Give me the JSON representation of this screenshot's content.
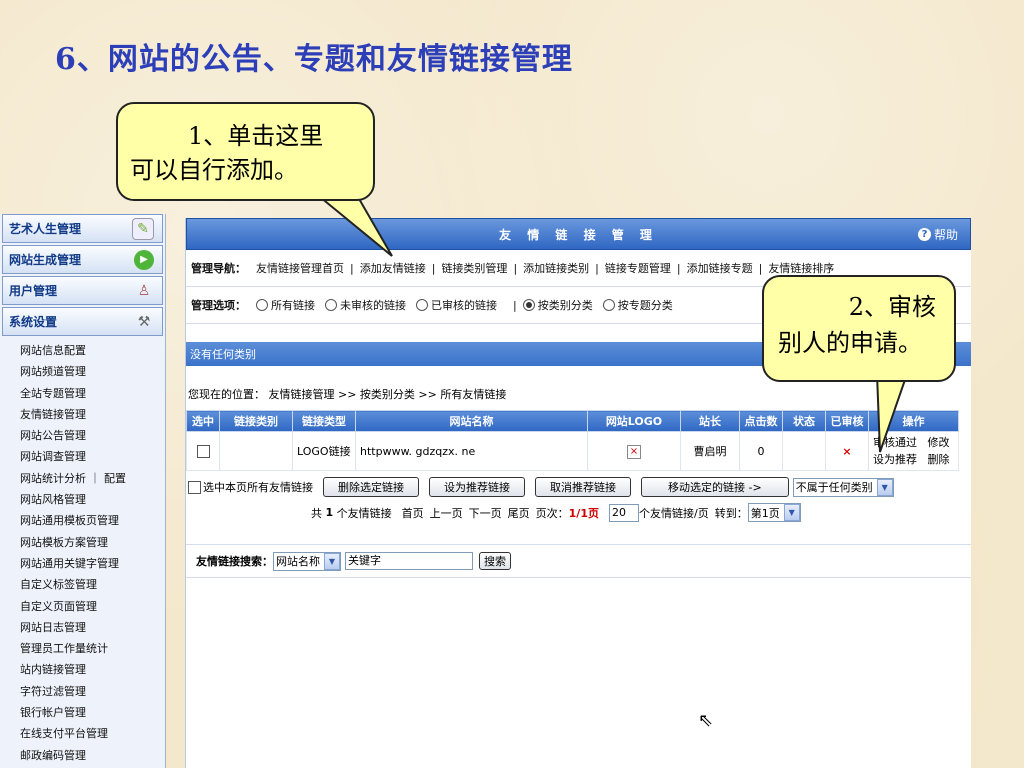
{
  "slide": {
    "title": "6、网站的公告、专题和友情链接管理",
    "callout1": {
      "line1": "1、单击这里",
      "line2": "可以自行添加。"
    },
    "callout2": {
      "line1": "2、审核",
      "line2": "别人的申请。"
    }
  },
  "sidebar": {
    "sections": [
      {
        "label": "艺术人生管理",
        "icon": "document-icon"
      },
      {
        "label": "网站生成管理",
        "icon": "play-icon"
      },
      {
        "label": "用户管理",
        "icon": "user-icon"
      },
      {
        "label": "系统设置",
        "icon": "tools-icon"
      }
    ],
    "items": [
      "网站信息配置",
      "网站频道管理",
      "全站专题管理",
      "友情链接管理",
      "网站公告管理",
      "网站调查管理",
      "网站统计分析 ｜ 配置",
      "网站风格管理",
      "网站通用模板页管理",
      "网站模板方案管理",
      "网站通用关键字管理",
      "自定义标签管理",
      "自定义页面管理",
      "网站日志管理",
      "管理员工作量统计",
      "站内链接管理",
      "字符过滤管理",
      "银行帐户管理",
      "在线支付平台管理",
      "邮政编码管理"
    ]
  },
  "main": {
    "title": "友 情 链 接 管 理",
    "help": "帮助",
    "nav": {
      "label": "管理导航：",
      "links": [
        "友情链接管理首页",
        "添加友情链接",
        "链接类别管理",
        "添加链接类别",
        "链接专题管理",
        "添加链接专题",
        "友情链接排序"
      ]
    },
    "options": {
      "label": "管理选项：",
      "radios": [
        {
          "label": "所有链接",
          "checked": false
        },
        {
          "label": "未审核的链接",
          "checked": false
        },
        {
          "label": "已审核的链接",
          "checked": false
        },
        {
          "label": "按类别分类",
          "checked": true
        },
        {
          "label": "按专题分类",
          "checked": false
        }
      ]
    },
    "category_bar": "没有任何类别",
    "breadcrumb": "您现在的位置： 友情链接管理 >> 按类别分类 >> 所有友情链接",
    "table": {
      "headers": [
        "选中",
        "链接类别",
        "链接类型",
        "网站名称",
        "网站LOGO",
        "站长",
        "点击数",
        "状态",
        "已审核",
        "操作"
      ],
      "rows": [
        {
          "category": "",
          "type": "LOGO链接",
          "name": "httpwww. gdzqzx. ne",
          "owner": "曹启明",
          "clicks": "0",
          "status": "",
          "approved": "×",
          "action1": "审核通过",
          "action2": "修改",
          "action3": "设为推荐",
          "action4": "删除"
        }
      ]
    },
    "bulk": {
      "select_all": "选中本页所有友情链接",
      "buttons": [
        "删除选定链接",
        "设为推荐链接",
        "取消推荐链接",
        "移动选定的链接 ->"
      ],
      "move_target": "不属于任何类别"
    },
    "pager": {
      "total_prefix": "共",
      "total": "1",
      "total_suffix": "个友情链接",
      "first": "首页",
      "prev": "上一页",
      "next": "下一页",
      "last": "尾页",
      "page_label": "页次：",
      "page": "1/1页",
      "per_page": "20",
      "per_page_suffix": "个友情链接/页",
      "goto_label": "转到：",
      "goto_value": "第1页"
    },
    "search": {
      "label": "友情链接搜索：",
      "field": "网站名称",
      "keyword": "关键字",
      "button": "搜索"
    }
  },
  "colors": {
    "title": "#2c3fb8",
    "header_blue": "#2f67c3",
    "callout_bg": "#ffffa8"
  }
}
